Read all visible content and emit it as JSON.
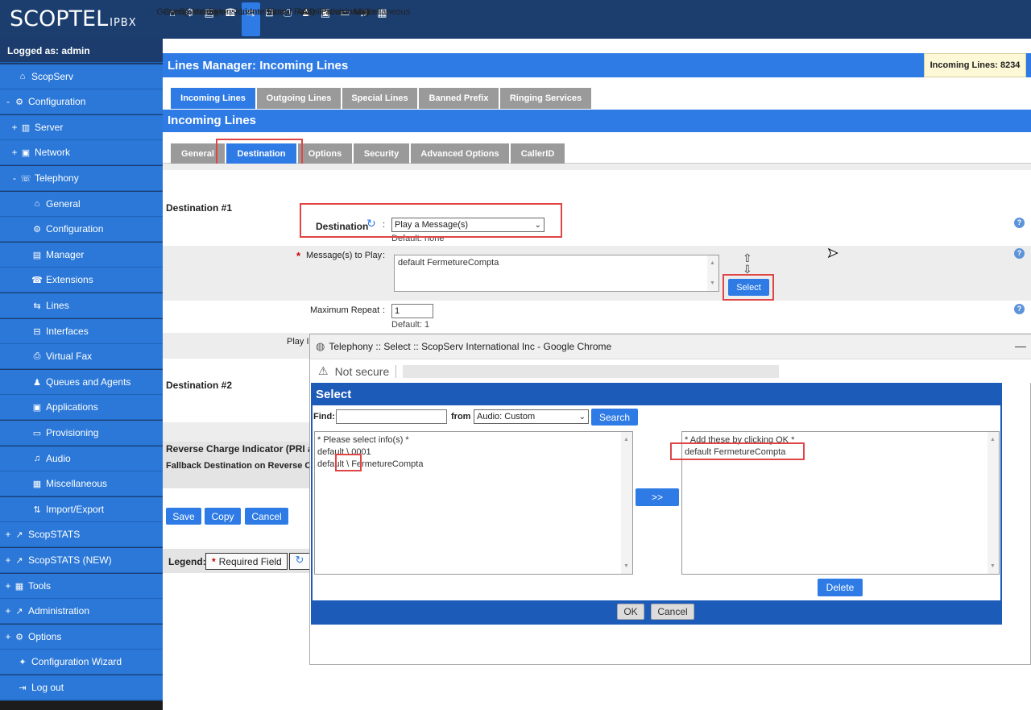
{
  "app": {
    "logo": "SCOPTEL",
    "logo_suffix": "IPBX"
  },
  "topnav": [
    {
      "label": "General",
      "icon": "home-icon",
      "glyph": "⌂"
    },
    {
      "label": "Configuration",
      "icon": "gear-icon",
      "glyph": "⚙"
    },
    {
      "label": "Manager",
      "icon": "manager-icon",
      "glyph": "▤"
    },
    {
      "label": "Extensions",
      "icon": "phone-icon",
      "glyph": "☎"
    },
    {
      "label": "Lines",
      "icon": "lines-icon",
      "glyph": "⇆"
    },
    {
      "label": "Interfaces",
      "icon": "interfaces-icon",
      "glyph": "⊟"
    },
    {
      "label": "Virtual Fax",
      "icon": "fax-icon",
      "glyph": "⎙"
    },
    {
      "label": "ACD",
      "icon": "user-icon",
      "glyph": "♟"
    },
    {
      "label": "Applications",
      "icon": "applications-icon",
      "glyph": "▣"
    },
    {
      "label": "Provisioning",
      "icon": "provisioning-icon",
      "glyph": "▭"
    },
    {
      "label": "Audio",
      "icon": "music-icon",
      "glyph": "♫"
    },
    {
      "label": "Miscellaneous",
      "icon": "grid-icon",
      "glyph": "▦"
    }
  ],
  "sidebar": {
    "logged_as": "Logged as: admin",
    "items": [
      {
        "label": "ScopServ",
        "pm": "",
        "glyph": "⌂",
        "icon": "home-icon"
      },
      {
        "label": "Configuration",
        "pm": "-",
        "glyph": "⚙",
        "icon": "gear-icon"
      },
      {
        "label": "Server",
        "pm": "+",
        "glyph": "▥",
        "icon": "server-icon"
      },
      {
        "label": "Network",
        "pm": "+",
        "glyph": "▣",
        "icon": "network-icon"
      },
      {
        "label": "Telephony",
        "pm": "-",
        "glyph": "☏",
        "icon": "telephony-icon"
      },
      {
        "label": "General",
        "pm": "",
        "glyph": "⌂",
        "icon": "home-icon"
      },
      {
        "label": "Configuration",
        "pm": "",
        "glyph": "⚙",
        "icon": "gear-icon"
      },
      {
        "label": "Manager",
        "pm": "",
        "glyph": "▤",
        "icon": "manager-icon"
      },
      {
        "label": "Extensions",
        "pm": "",
        "glyph": "☎",
        "icon": "phone-icon"
      },
      {
        "label": "Lines",
        "pm": "",
        "glyph": "⇆",
        "icon": "lines-icon"
      },
      {
        "label": "Interfaces",
        "pm": "",
        "glyph": "⊟",
        "icon": "interfaces-icon"
      },
      {
        "label": "Virtual Fax",
        "pm": "",
        "glyph": "⎙",
        "icon": "fax-icon"
      },
      {
        "label": "Queues and Agents",
        "pm": "",
        "glyph": "♟",
        "icon": "user-icon"
      },
      {
        "label": "Applications",
        "pm": "",
        "glyph": "▣",
        "icon": "applications-icon"
      },
      {
        "label": "Provisioning",
        "pm": "",
        "glyph": "▭",
        "icon": "provisioning-icon"
      },
      {
        "label": "Audio",
        "pm": "",
        "glyph": "♫",
        "icon": "music-icon"
      },
      {
        "label": "Miscellaneous",
        "pm": "",
        "glyph": "▦",
        "icon": "grid-icon"
      },
      {
        "label": "Import/Export",
        "pm": "",
        "glyph": "⇅",
        "icon": "import-export-icon"
      },
      {
        "label": "ScopSTATS",
        "pm": "+",
        "glyph": "↗",
        "icon": "stats-icon"
      },
      {
        "label": "ScopSTATS (NEW)",
        "pm": "+",
        "glyph": "↗",
        "icon": "stats-icon"
      },
      {
        "label": "Tools",
        "pm": "+",
        "glyph": "▦",
        "icon": "tools-icon"
      },
      {
        "label": "Administration",
        "pm": "+",
        "glyph": "↗",
        "icon": "admin-icon"
      },
      {
        "label": "Options",
        "pm": "+",
        "glyph": "⚙",
        "icon": "gear-icon"
      },
      {
        "label": "Configuration Wizard",
        "pm": "",
        "glyph": "✦",
        "icon": "wizard-icon"
      },
      {
        "label": "Log out",
        "pm": "",
        "glyph": "⇥",
        "icon": "logout-icon"
      }
    ]
  },
  "header": {
    "title": "Lines Manager:  Incoming Lines",
    "count": "Incoming Lines: 8234"
  },
  "tabs": [
    "Incoming Lines",
    "Outgoing Lines",
    "Special Lines",
    "Banned Prefix",
    "Ringing Services"
  ],
  "section_title": "Incoming Lines",
  "subtabs": [
    "General",
    "Destination",
    "Options",
    "Security",
    "Advanced Options",
    "CallerID"
  ],
  "form": {
    "dest1": "Destination #1",
    "dest_label": "Destination",
    "dest_value": "Play a Message(s)",
    "dest_default": "Default: none",
    "messages_label": "Message(s) to Play",
    "messages_value": "default FermetureCompta",
    "select_btn": "Select",
    "max_repeat_label": "Maximum Repeat",
    "max_repeat_value": "1",
    "max_repeat_default": "Default: 1",
    "play_label": "Play In",
    "dest2": "Destination #2",
    "reverse_charge": "Reverse Charge Indicator (PRI an",
    "fallback": "Fallback Destination on Reverse Ch",
    "save": "Save",
    "copy": "Copy",
    "cancel": "Cancel",
    "legend": "Legend:",
    "required": "Required Field",
    "colon": ":",
    "star": "*",
    "help": "?"
  },
  "popup": {
    "window_title": "Telephony :: Select :: ScopServ International Inc - Google Chrome",
    "not_secure": "Not secure",
    "select_title": "Select",
    "find_label": "Find:",
    "find_value": "",
    "from_label": "from",
    "from_value": "Audio: Custom",
    "search_btn": "Search",
    "left_list": [
      "* Please select info(s) *",
      "default \\ 0001",
      "default \\ FermetureCompta"
    ],
    "right_list": [
      "* Add these by clicking OK *",
      "default FermetureCompta"
    ],
    "move_btn": ">>",
    "delete_btn": "Delete",
    "ok_btn": "OK",
    "cancel_btn": "Cancel"
  }
}
